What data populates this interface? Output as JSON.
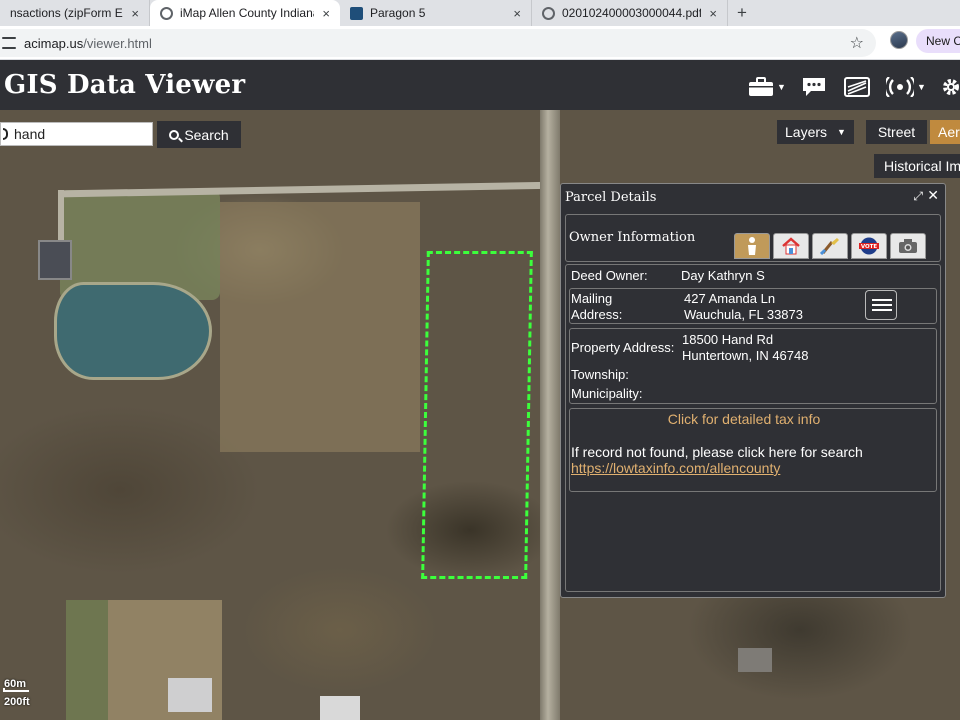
{
  "browser": {
    "tabs": [
      {
        "title": "nsactions (zipForm Editio"
      },
      {
        "title": "iMap Allen County Indiana"
      },
      {
        "title": "Paragon 5"
      },
      {
        "title": "020102400003000044.pdf"
      }
    ],
    "close_glyph": "×",
    "new_tab_glyph": "+",
    "url_host": "acimap.us",
    "url_path": "/viewer.html",
    "star_glyph": "☆",
    "new_chrome_label": "New Cl"
  },
  "header": {
    "title": "GIS Data Viewer",
    "icons": [
      "briefcase-icon",
      "comment-icon",
      "basemap-icon",
      "signal-icon",
      "settings-icon"
    ]
  },
  "search": {
    "value": "hand",
    "button_label": "Search"
  },
  "map_controls": {
    "layers_label": "Layers",
    "street_label": "Street",
    "aerial_label": "Aerial",
    "historical_label": "Historical Imagery",
    "scale_m": "60m",
    "scale_ft": "200ft"
  },
  "parcel_panel": {
    "title": "Parcel Details",
    "owner_info_label": "Owner Information",
    "tabs": [
      "owner-icon",
      "house-icon",
      "brush-icon",
      "vote-icon",
      "camera-icon"
    ],
    "vote_text": "VOTE",
    "deed_owner_label": "Deed Owner:",
    "deed_owner_value": "Day Kathryn S",
    "mailing_label_1": "Mailing",
    "mailing_label_2": "Address:",
    "mailing_line1": "427 Amanda Ln",
    "mailing_line2": "Wauchula, FL 33873",
    "property_label": "Property Address:",
    "property_line1": "18500 Hand Rd",
    "property_line2": "Huntertown, IN 46748",
    "township_label": "Township:",
    "municipality_label": "Municipality:",
    "tax_link": "Click for detailed tax info",
    "not_found_text": "If record not found, please click here for search",
    "lowtax_url": "https://lowtaxinfo.com/allencounty"
  },
  "colors": {
    "header_bg": "#2f3035",
    "accent_gold": "#c08a3e",
    "link_gold": "#e0b070",
    "parcel_outline": "#3cff3c"
  }
}
